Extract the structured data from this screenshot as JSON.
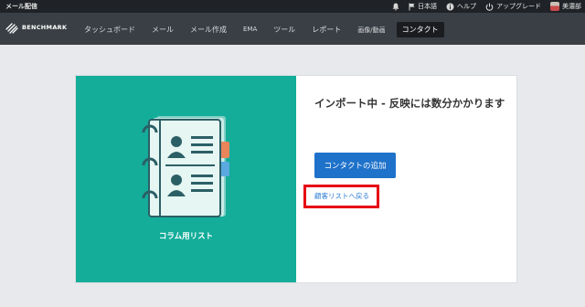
{
  "topbar": {
    "app_title": "メール配信",
    "items": [
      {
        "icon": "bell-icon",
        "label": ""
      },
      {
        "icon": "flag-icon",
        "label": "日本語"
      },
      {
        "icon": "info-icon",
        "label": "ヘルプ"
      },
      {
        "icon": "power-icon",
        "label": "アップグレード"
      },
      {
        "icon": "avatar",
        "label": "美濃部"
      }
    ]
  },
  "navbar": {
    "brand": "BENCHMARK",
    "items": [
      {
        "label": "タッシュボード"
      },
      {
        "label": "メール"
      },
      {
        "label": "メール作成"
      },
      {
        "label": "EMA"
      },
      {
        "label": "ツール"
      },
      {
        "label": "レポート"
      },
      {
        "label": "画像/動画"
      },
      {
        "label": "コンタクト"
      }
    ],
    "active_index": 7
  },
  "card": {
    "list_name": "コラム用リスト",
    "import_message": "インポート中 - 反映には数分かかります",
    "add_contact_button": "コンタクトの追加",
    "back_link": "顧客リストへ戻る"
  },
  "colors": {
    "teal_panel": "#13ad9a",
    "primary_button": "#1f72c9",
    "highlight_box": "#e60012",
    "nav_background": "#3a3f45"
  }
}
